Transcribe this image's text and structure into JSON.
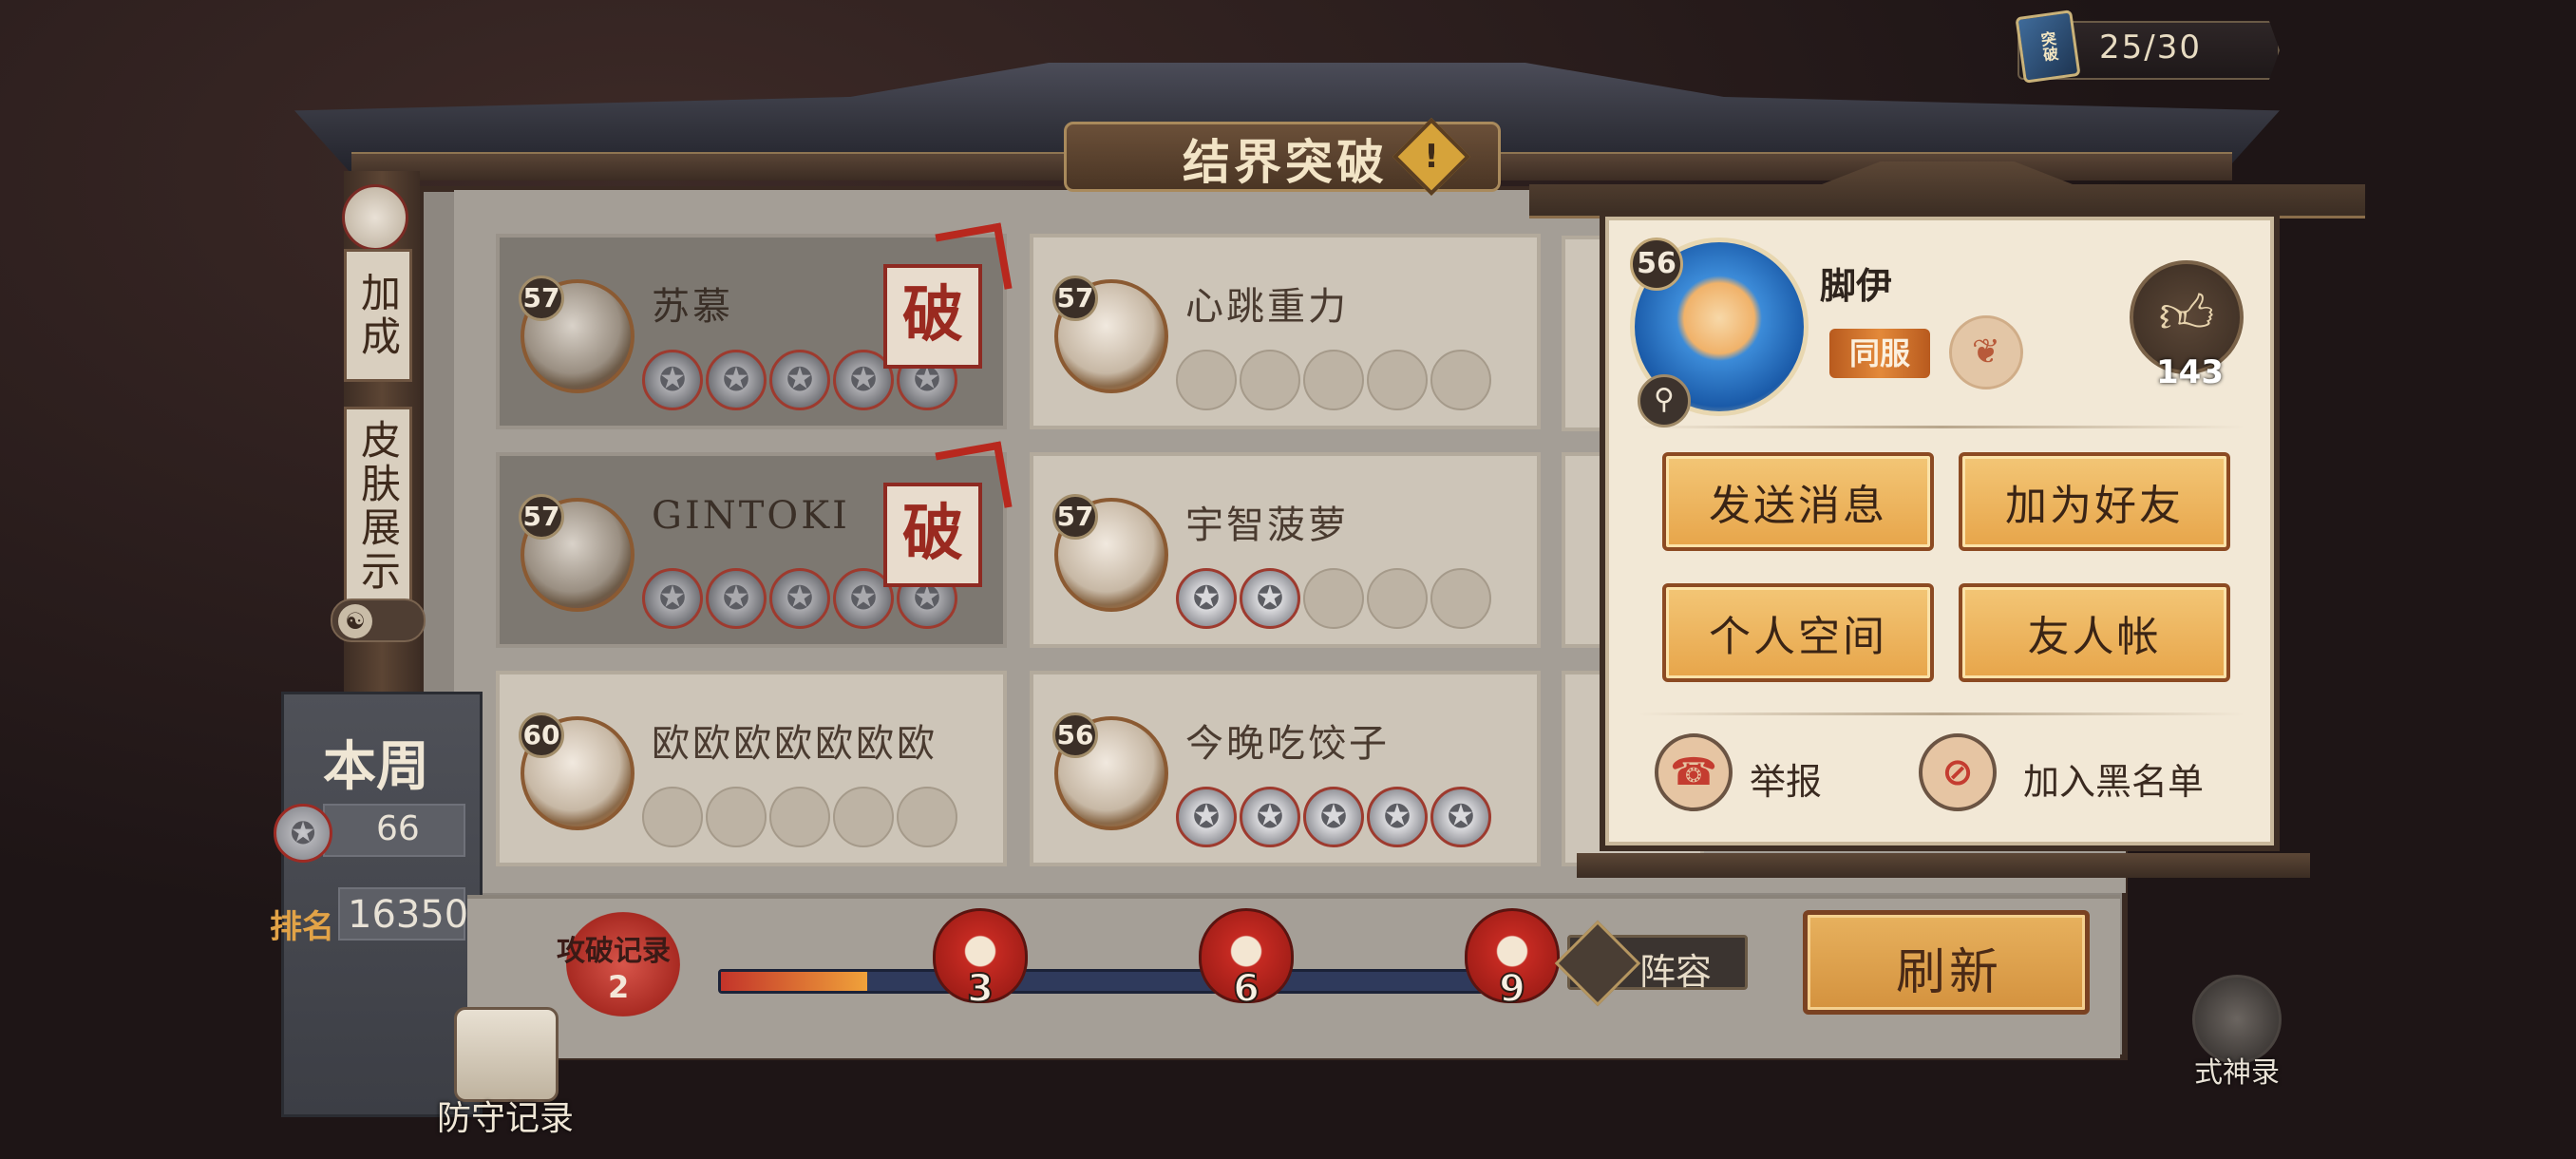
{
  "stamina": {
    "text": "25/30",
    "icon_label": "突破"
  },
  "title": "结界突破",
  "side_tabs": {
    "bonus": "加成",
    "skin": "皮肤展示"
  },
  "week": {
    "title": "本周",
    "medals": "66",
    "rank_label": "排名",
    "rank_value": "16350"
  },
  "opponents": [
    {
      "name": "苏慕",
      "level": "57",
      "won_medals": 5,
      "broken": true
    },
    {
      "name": "心跳重力",
      "level": "57",
      "won_medals": 0,
      "broken": false
    },
    {
      "name": "GINTOKI",
      "level": "57",
      "won_medals": 5,
      "broken": true
    },
    {
      "name": "宇智菠萝",
      "level": "57",
      "won_medals": 2,
      "broken": false
    },
    {
      "name": "欧欧欧欧欧欧欧",
      "level": "60",
      "won_medals": 0,
      "broken": false
    },
    {
      "name": "今晚吃饺子",
      "level": "56",
      "won_medals": 5,
      "broken": false
    }
  ],
  "break_stamp": "破",
  "attack_record": {
    "label": "攻破记录",
    "count": "2"
  },
  "progress": {
    "fraction": 0.18,
    "milestones": [
      "3",
      "6",
      "9"
    ]
  },
  "lineup_label": "阵容",
  "refresh_label": "刷新",
  "defense_record_label": "防守记录",
  "shikigami_label": "式神录",
  "profile": {
    "level": "56",
    "name": "脚伊",
    "server_badge": "同服",
    "likes": "143",
    "buttons": {
      "send_message": "发送消息",
      "add_friend": "加为好友",
      "personal_space": "个人空间",
      "friend_account": "友人帐"
    },
    "report": "举报",
    "blacklist": "加入黑名单"
  },
  "colors": {
    "accent_gold": "#e7a54a",
    "stamp_red": "#9a2a20",
    "progress_red": "#c3342a"
  },
  "icons": {
    "medal": "star-medal-icon",
    "search": "magnifier-icon",
    "like": "thumbs-up-icon",
    "report": "phone-report-icon",
    "blacklist": "prohibited-icon"
  }
}
